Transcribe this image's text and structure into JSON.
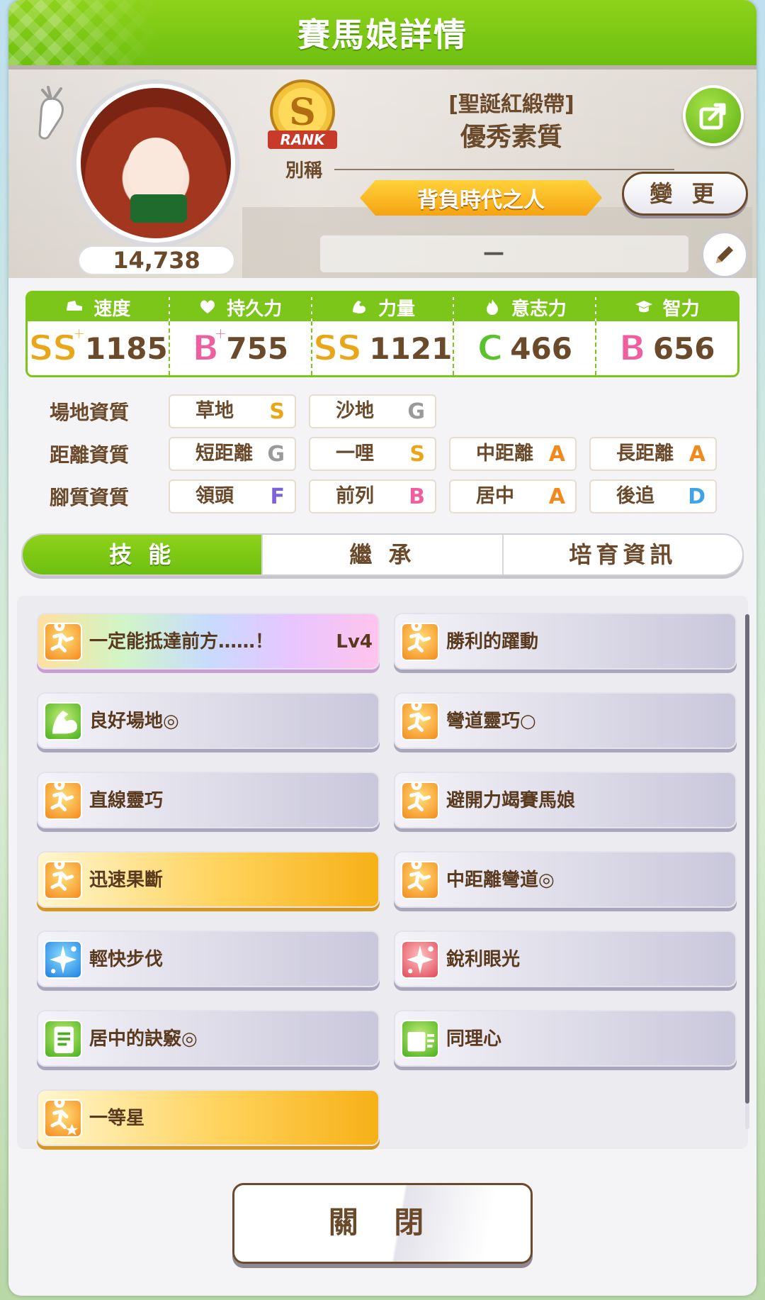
{
  "header": {
    "title": "賽馬娘詳情"
  },
  "profile": {
    "fans": "14,738",
    "rank_badge_letter": "S",
    "rank_badge_text": "RANK",
    "alias_label": "別稱",
    "outfit": "[聖誕紅緞帶]",
    "name": "優秀素質",
    "title": "背負時代之人",
    "change_label": "變 更",
    "memo": "—"
  },
  "stats": [
    {
      "label": "速度",
      "icon": "shoe-icon",
      "grade": "SS",
      "plus": "+",
      "value": "1185",
      "color": "#e8a618"
    },
    {
      "label": "持久力",
      "icon": "heart-icon",
      "grade": "B",
      "plus": "+",
      "value": "755",
      "color": "#ef5fa0"
    },
    {
      "label": "力量",
      "icon": "muscle-icon",
      "grade": "SS",
      "plus": "",
      "value": "1121",
      "color": "#e8a618"
    },
    {
      "label": "意志力",
      "icon": "flame-icon",
      "grade": "C",
      "plus": "",
      "value": "466",
      "color": "#58c32a"
    },
    {
      "label": "智力",
      "icon": "graduation-cap-icon",
      "grade": "B",
      "plus": "",
      "value": "656",
      "color": "#ef5fa0"
    }
  ],
  "aptitudes": {
    "track": {
      "label": "場地資質",
      "items": [
        {
          "name": "草地",
          "grade": "S"
        },
        {
          "name": "沙地",
          "grade": "G"
        }
      ]
    },
    "distance": {
      "label": "距離資質",
      "items": [
        {
          "name": "短距離",
          "grade": "G"
        },
        {
          "name": "一哩",
          "grade": "S"
        },
        {
          "name": "中距離",
          "grade": "A"
        },
        {
          "name": "長距離",
          "grade": "A"
        }
      ]
    },
    "style": {
      "label": "腳質資質",
      "items": [
        {
          "name": "領頭",
          "grade": "F"
        },
        {
          "name": "前列",
          "grade": "B"
        },
        {
          "name": "居中",
          "grade": "A"
        },
        {
          "name": "後追",
          "grade": "D"
        }
      ]
    }
  },
  "grade_colors": {
    "S": "#e8a618",
    "A": "#f08a1e",
    "B": "#ef5fa0",
    "C": "#58c32a",
    "D": "#3fa3e6",
    "F": "#7d62d8",
    "G": "#9a9a9a"
  },
  "tabs": [
    "技 能",
    "繼 承",
    "培育資訊"
  ],
  "skills": [
    {
      "name": "一定能抵達前方……！",
      "level": "Lv4",
      "style": "rainbow",
      "icon": "runner-icon",
      "icon_color": "orange"
    },
    {
      "name": "勝利的躍動",
      "level": "",
      "style": "normal",
      "icon": "runner-icon",
      "icon_color": "orange"
    },
    {
      "name": "良好場地◎",
      "level": "",
      "style": "normal",
      "icon": "muscle-icon",
      "icon_color": "green"
    },
    {
      "name": "彎道靈巧○",
      "level": "",
      "style": "normal",
      "icon": "runner-icon",
      "icon_color": "orange"
    },
    {
      "name": "直線靈巧",
      "level": "",
      "style": "normal",
      "icon": "runner-icon",
      "icon_color": "orange"
    },
    {
      "name": "避開力竭賽馬娘",
      "level": "",
      "style": "normal",
      "icon": "runner-icon",
      "icon_color": "orange"
    },
    {
      "name": "迅速果斷",
      "level": "",
      "style": "gold",
      "icon": "runner-icon",
      "icon_color": "orange"
    },
    {
      "name": "中距離彎道◎",
      "level": "",
      "style": "normal",
      "icon": "runner-icon",
      "icon_color": "orange"
    },
    {
      "name": "輕快步伐",
      "level": "",
      "style": "normal",
      "icon": "sparkle-icon",
      "icon_color": "blue"
    },
    {
      "name": "銳利眼光",
      "level": "",
      "style": "normal",
      "icon": "sparkle-icon",
      "icon_color": "red"
    },
    {
      "name": "居中的訣竅◎",
      "level": "",
      "style": "normal",
      "icon": "scroll-icon",
      "icon_color": "green"
    },
    {
      "name": "同理心",
      "level": "",
      "style": "normal",
      "icon": "card-icon",
      "icon_color": "green"
    },
    {
      "name": "一等星",
      "level": "",
      "style": "gold",
      "icon": "runner-star-icon",
      "icon_color": "orange"
    }
  ],
  "close_label": "關 閉"
}
